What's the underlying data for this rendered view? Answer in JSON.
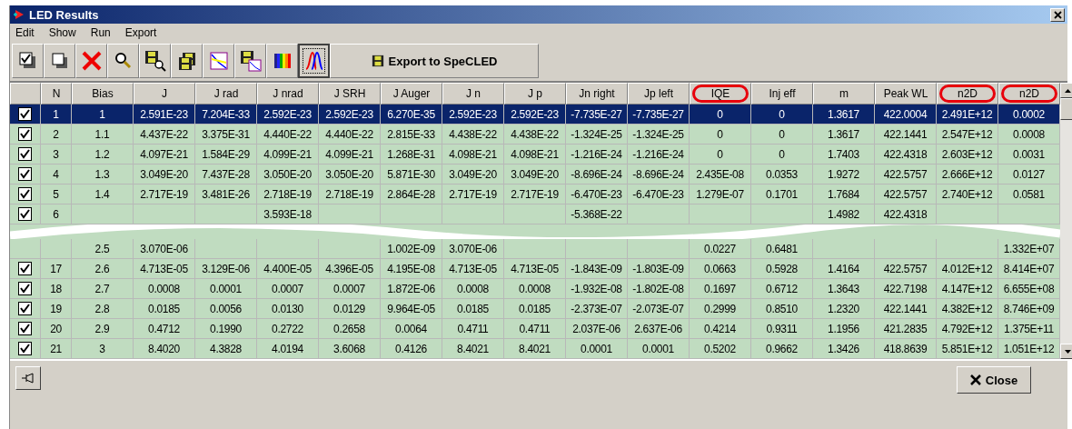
{
  "window": {
    "title": "LED Results"
  },
  "menu": [
    "Edit",
    "Show",
    "Run",
    "Export"
  ],
  "toolbar": [
    {
      "kind": "check-stack",
      "pressed": false
    },
    {
      "kind": "page-stack",
      "pressed": false
    },
    {
      "kind": "delete",
      "pressed": false
    },
    {
      "kind": "magnifier",
      "pressed": false
    },
    {
      "kind": "disk-magnifier",
      "pressed": false
    },
    {
      "kind": "disk-stack",
      "pressed": false
    },
    {
      "kind": "chart",
      "pressed": false
    },
    {
      "kind": "disk-chart",
      "pressed": false
    },
    {
      "kind": "spectrum",
      "pressed": false
    },
    {
      "kind": "peaks",
      "pressed": true
    }
  ],
  "export_button": "Export to SpeCLED",
  "table": {
    "columns": [
      {
        "label": "N",
        "circled": false
      },
      {
        "label": "Bias",
        "circled": false
      },
      {
        "label": "J",
        "circled": false
      },
      {
        "label": "J rad",
        "circled": false
      },
      {
        "label": "J nrad",
        "circled": false
      },
      {
        "label": "J SRH",
        "circled": false
      },
      {
        "label": "J Auger",
        "circled": false
      },
      {
        "label": "J n",
        "circled": false
      },
      {
        "label": "J p",
        "circled": false
      },
      {
        "label": "Jn right",
        "circled": false
      },
      {
        "label": "Jp left",
        "circled": false
      },
      {
        "label": "IQE",
        "circled": true
      },
      {
        "label": "Inj eff",
        "circled": false
      },
      {
        "label": "m",
        "circled": false
      },
      {
        "label": "Peak WL",
        "circled": false
      },
      {
        "label": "n2D",
        "circled": true
      },
      {
        "label": "n2D",
        "circled": true
      }
    ],
    "rows": [
      {
        "kind": "row",
        "selected": true,
        "checked": true,
        "cells": [
          "1",
          "1",
          "2.591E-23",
          "7.204E-33",
          "2.592E-23",
          "2.592E-23",
          "6.270E-35",
          "2.592E-23",
          "2.592E-23",
          "-7.735E-27",
          "-7.735E-27",
          "0",
          "0",
          "1.3617",
          "422.0004",
          "2.491E+12",
          "0.0002"
        ]
      },
      {
        "kind": "row",
        "selected": false,
        "checked": true,
        "cells": [
          "2",
          "1.1",
          "4.437E-22",
          "3.375E-31",
          "4.440E-22",
          "4.440E-22",
          "2.815E-33",
          "4.438E-22",
          "4.438E-22",
          "-1.324E-25",
          "-1.324E-25",
          "0",
          "0",
          "1.3617",
          "422.1441",
          "2.547E+12",
          "0.0008"
        ]
      },
      {
        "kind": "row",
        "selected": false,
        "checked": true,
        "cells": [
          "3",
          "1.2",
          "4.097E-21",
          "1.584E-29",
          "4.099E-21",
          "4.099E-21",
          "1.268E-31",
          "4.098E-21",
          "4.098E-21",
          "-1.216E-24",
          "-1.216E-24",
          "0",
          "0",
          "1.7403",
          "422.4318",
          "2.603E+12",
          "0.0031"
        ]
      },
      {
        "kind": "row",
        "selected": false,
        "checked": true,
        "cells": [
          "4",
          "1.3",
          "3.049E-20",
          "7.437E-28",
          "3.050E-20",
          "3.050E-20",
          "5.871E-30",
          "3.049E-20",
          "3.049E-20",
          "-8.696E-24",
          "-8.696E-24",
          "2.435E-08",
          "0.0353",
          "1.9272",
          "422.5757",
          "2.666E+12",
          "0.0127"
        ]
      },
      {
        "kind": "row",
        "selected": false,
        "checked": true,
        "cells": [
          "5",
          "1.4",
          "2.717E-19",
          "3.481E-26",
          "2.718E-19",
          "2.718E-19",
          "2.864E-28",
          "2.717E-19",
          "2.717E-19",
          "-6.470E-23",
          "-6.470E-23",
          "1.279E-07",
          "0.1701",
          "1.7684",
          "422.5757",
          "2.740E+12",
          "0.0581"
        ]
      },
      {
        "kind": "row",
        "selected": false,
        "checked": true,
        "cells": [
          "6",
          null,
          null,
          null,
          "3.593E-18",
          null,
          null,
          null,
          null,
          "-5.368E-22",
          null,
          null,
          null,
          "1.4982",
          "422.4318",
          null,
          null
        ]
      },
      {
        "kind": "break"
      },
      {
        "kind": "row",
        "selected": false,
        "checked": null,
        "cells": [
          null,
          "2.5",
          "3.070E-06",
          null,
          null,
          null,
          "1.002E-09",
          "3.070E-06",
          null,
          null,
          null,
          "0.0227",
          "0.6481",
          null,
          null,
          null,
          "1.332E+07"
        ]
      },
      {
        "kind": "row",
        "selected": false,
        "checked": true,
        "cells": [
          "17",
          "2.6",
          "4.713E-05",
          "3.129E-06",
          "4.400E-05",
          "4.396E-05",
          "4.195E-08",
          "4.713E-05",
          "4.713E-05",
          "-1.843E-09",
          "-1.803E-09",
          "0.0663",
          "0.5928",
          "1.4164",
          "422.5757",
          "4.012E+12",
          "8.414E+07"
        ]
      },
      {
        "kind": "row",
        "selected": false,
        "checked": true,
        "cells": [
          "18",
          "2.7",
          "0.0008",
          "0.0001",
          "0.0007",
          "0.0007",
          "1.872E-06",
          "0.0008",
          "0.0008",
          "-1.932E-08",
          "-1.802E-08",
          "0.1697",
          "0.6712",
          "1.3643",
          "422.7198",
          "4.147E+12",
          "6.655E+08"
        ]
      },
      {
        "kind": "row",
        "selected": false,
        "checked": true,
        "cells": [
          "19",
          "2.8",
          "0.0185",
          "0.0056",
          "0.0130",
          "0.0129",
          "9.964E-05",
          "0.0185",
          "0.0185",
          "-2.373E-07",
          "-2.073E-07",
          "0.2999",
          "0.8510",
          "1.2320",
          "422.1441",
          "4.382E+12",
          "8.746E+09"
        ]
      },
      {
        "kind": "row",
        "selected": false,
        "checked": true,
        "cells": [
          "20",
          "2.9",
          "0.4712",
          "0.1990",
          "0.2722",
          "0.2658",
          "0.0064",
          "0.4711",
          "0.4711",
          "2.037E-06",
          "2.637E-06",
          "0.4214",
          "0.9311",
          "1.1956",
          "421.2835",
          "4.792E+12",
          "1.375E+11"
        ]
      },
      {
        "kind": "row",
        "selected": false,
        "checked": true,
        "cells": [
          "21",
          "3",
          "8.4020",
          "4.3828",
          "4.0194",
          "3.6068",
          "0.4126",
          "8.4021",
          "8.4021",
          "0.0001",
          "0.0001",
          "0.5202",
          "0.9662",
          "1.3426",
          "418.8639",
          "5.851E+12",
          "1.051E+12"
        ]
      }
    ]
  },
  "close_button": "Close"
}
